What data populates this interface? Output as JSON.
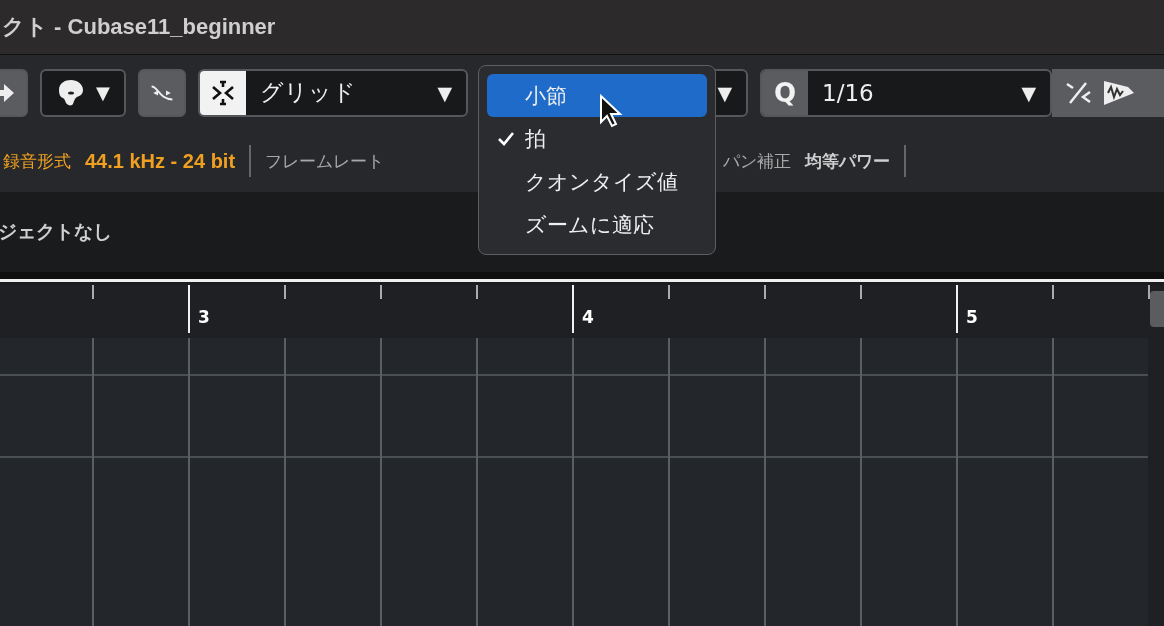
{
  "window": {
    "title": "クト - Cubase11_beginner"
  },
  "toolbar": {
    "mode": {
      "caret": "▼"
    },
    "snap_type": {
      "value": "グリッド",
      "caret": "▼"
    },
    "snap_value": {
      "caret": "▼"
    },
    "quantize": {
      "label": "Q",
      "value": "1/16",
      "caret": "▼"
    }
  },
  "info_line": [
    {
      "kind": "format",
      "label": "録音形式",
      "value": "44.1 kHz - 24 bit"
    },
    {
      "kind": "setting",
      "label": "フレームレート"
    },
    {
      "kind": "setting",
      "label": "パン補正",
      "value": "均等パワー"
    }
  ],
  "object_info": {
    "text": "ジェクトなし"
  },
  "ruler": {
    "bars": [
      "3",
      "4",
      "5"
    ]
  },
  "snap_menu": {
    "items": [
      {
        "label": "小節",
        "selected": true,
        "checked": false
      },
      {
        "label": "拍",
        "selected": false,
        "checked": true
      },
      {
        "label": "クオンタイズ値",
        "selected": false,
        "checked": false
      },
      {
        "label": "ズームに適応",
        "selected": false,
        "checked": false
      }
    ]
  }
}
